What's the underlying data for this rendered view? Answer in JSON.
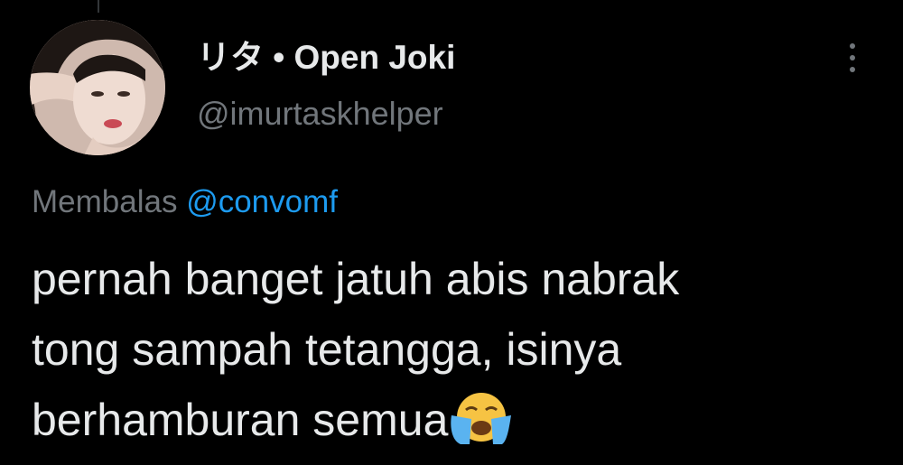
{
  "tweet": {
    "author": {
      "display_name": "リタ • Open Joki",
      "handle": "@imurtaskhelper",
      "avatar_icon": "profile-photo"
    },
    "more_icon": "more-vertical-icon",
    "reply_context": {
      "prefix": "Membalas",
      "mention": "@convomf"
    },
    "text_lines": [
      "pernah banget jatuh abis nabrak",
      "tong sampah tetangga, isinya",
      "berhamburan semua"
    ],
    "emoji": "loudly-crying-face-emoji"
  },
  "colors": {
    "background": "#000000",
    "primary_text": "#e7e9ea",
    "secondary_text": "#71767b",
    "link": "#1d9bf0"
  }
}
